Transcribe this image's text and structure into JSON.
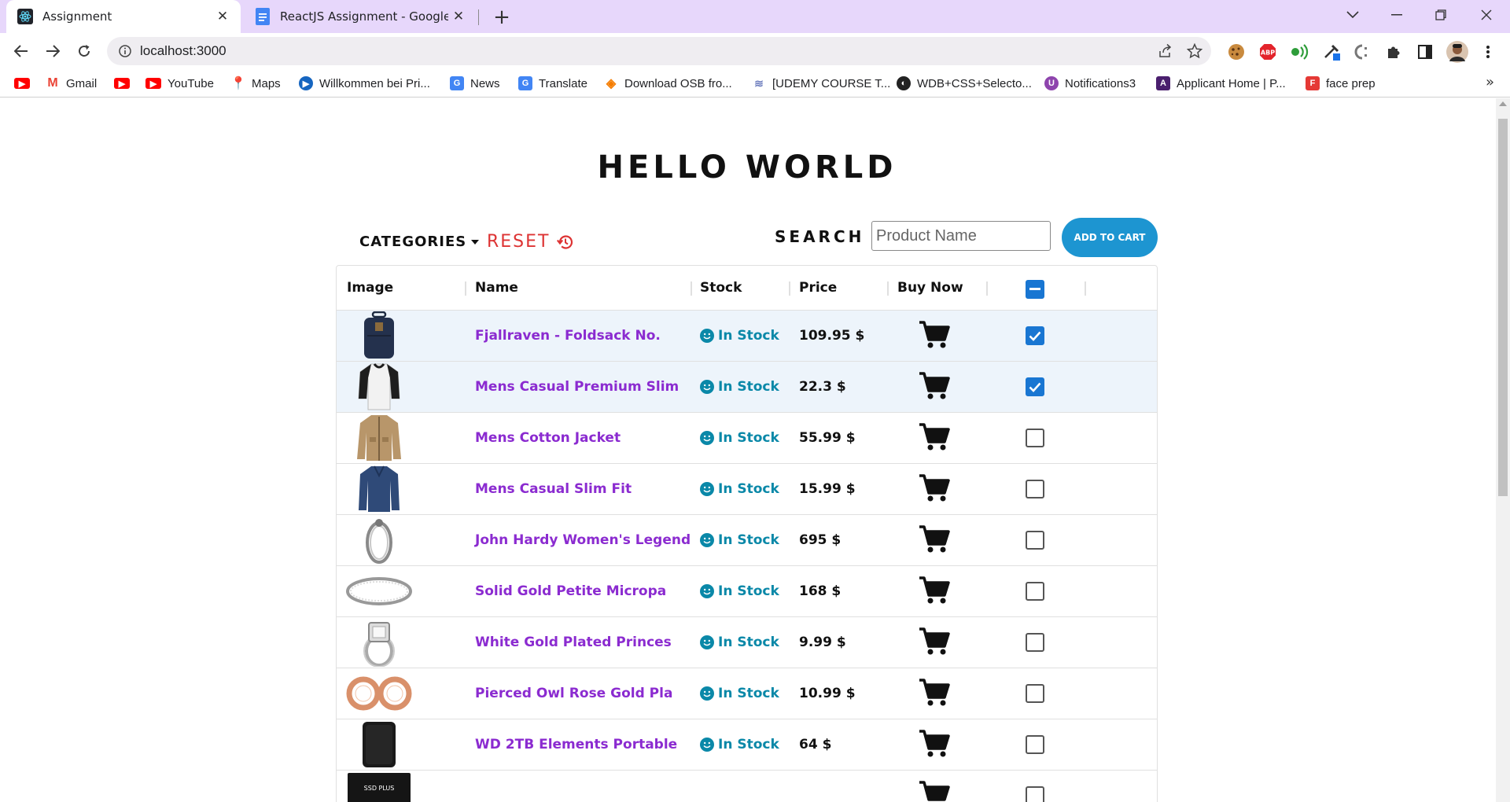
{
  "browser": {
    "tabs": [
      {
        "title": "Assignment",
        "active": true
      },
      {
        "title": "ReactJS Assignment - Google Do",
        "active": false
      }
    ],
    "url": "localhost:3000",
    "bookmarks": [
      {
        "label": "",
        "icon": "youtube-icon",
        "color": "#ff0000"
      },
      {
        "label": "Gmail",
        "icon": "gmail-icon",
        "color": "#ea4335"
      },
      {
        "label": "",
        "icon": "youtube-icon",
        "color": "#ff0000"
      },
      {
        "label": "YouTube",
        "icon": "youtube-icon",
        "color": "#ff0000"
      },
      {
        "label": "Maps",
        "icon": "maps-pin-icon",
        "color": "#34a853"
      },
      {
        "label": "Willkommen bei Pri...",
        "icon": "play-icon",
        "color": "#1565c0"
      },
      {
        "label": "News",
        "icon": "news-icon",
        "color": "#4285f4"
      },
      {
        "label": "Translate",
        "icon": "translate-icon",
        "color": "#4285f4"
      },
      {
        "label": "Download OSB fro...",
        "icon": "diamond-icon",
        "color": "#f57c00"
      },
      {
        "label": "[UDEMY COURSE T...",
        "icon": "udemy-icon",
        "color": "#6f7fbf"
      },
      {
        "label": "WDB+CSS+Selecto...",
        "icon": "globe-icon",
        "color": "#222222"
      },
      {
        "label": "Notifications3",
        "icon": "notification-icon",
        "color": "#8e44ad"
      },
      {
        "label": "Applicant Home | P...",
        "icon": "applicant-icon",
        "color": "#4a1f6e"
      },
      {
        "label": "face prep",
        "icon": "faceprep-icon",
        "color": "#e53935"
      }
    ]
  },
  "page": {
    "heading": "HELLO WORLD",
    "categories_label": "CATEGORIES",
    "reset_label": "RESET",
    "search_label": "SEARCH :",
    "search_placeholder": "Product Name",
    "add_to_cart_label": "ADD TO CART",
    "accent_color": "#1d95d1",
    "name_color": "#8b2bd0",
    "stock_color": "#0a88a8"
  },
  "table": {
    "headers": [
      "Image",
      "Name",
      "Stock",
      "Price",
      "Buy Now"
    ],
    "select_all_state": "indeterminate",
    "rows": [
      {
        "name": "Fjallraven - Foldsack No.",
        "stock": "In Stock",
        "price": "109.95 $",
        "checked": true,
        "image": "backpack"
      },
      {
        "name": "Mens Casual Premium Slim",
        "stock": "In Stock",
        "price": "22.3 $",
        "checked": true,
        "image": "raglan-shirt"
      },
      {
        "name": "Mens Cotton Jacket",
        "stock": "In Stock",
        "price": "55.99 $",
        "checked": false,
        "image": "jacket"
      },
      {
        "name": "Mens Casual Slim Fit",
        "stock": "In Stock",
        "price": "15.99 $",
        "checked": false,
        "image": "long-sleeve-shirt"
      },
      {
        "name": "John Hardy Women's Legend",
        "stock": "In Stock",
        "price": "695 $",
        "checked": false,
        "image": "bracelet"
      },
      {
        "name": "Solid Gold Petite Micropa",
        "stock": "In Stock",
        "price": "168 $",
        "checked": false,
        "image": "ring-band"
      },
      {
        "name": "White Gold Plated Princes",
        "stock": "In Stock",
        "price": "9.99 $",
        "checked": false,
        "image": "diamond-ring"
      },
      {
        "name": "Pierced Owl Rose Gold Pla",
        "stock": "In Stock",
        "price": "10.99 $",
        "checked": false,
        "image": "rose-gold-plugs"
      },
      {
        "name": "WD 2TB Elements Portable",
        "stock": "In Stock",
        "price": "64 $",
        "checked": false,
        "image": "hard-drive"
      },
      {
        "name": "",
        "stock": "",
        "price": "",
        "checked": false,
        "image": "ssd"
      }
    ]
  }
}
